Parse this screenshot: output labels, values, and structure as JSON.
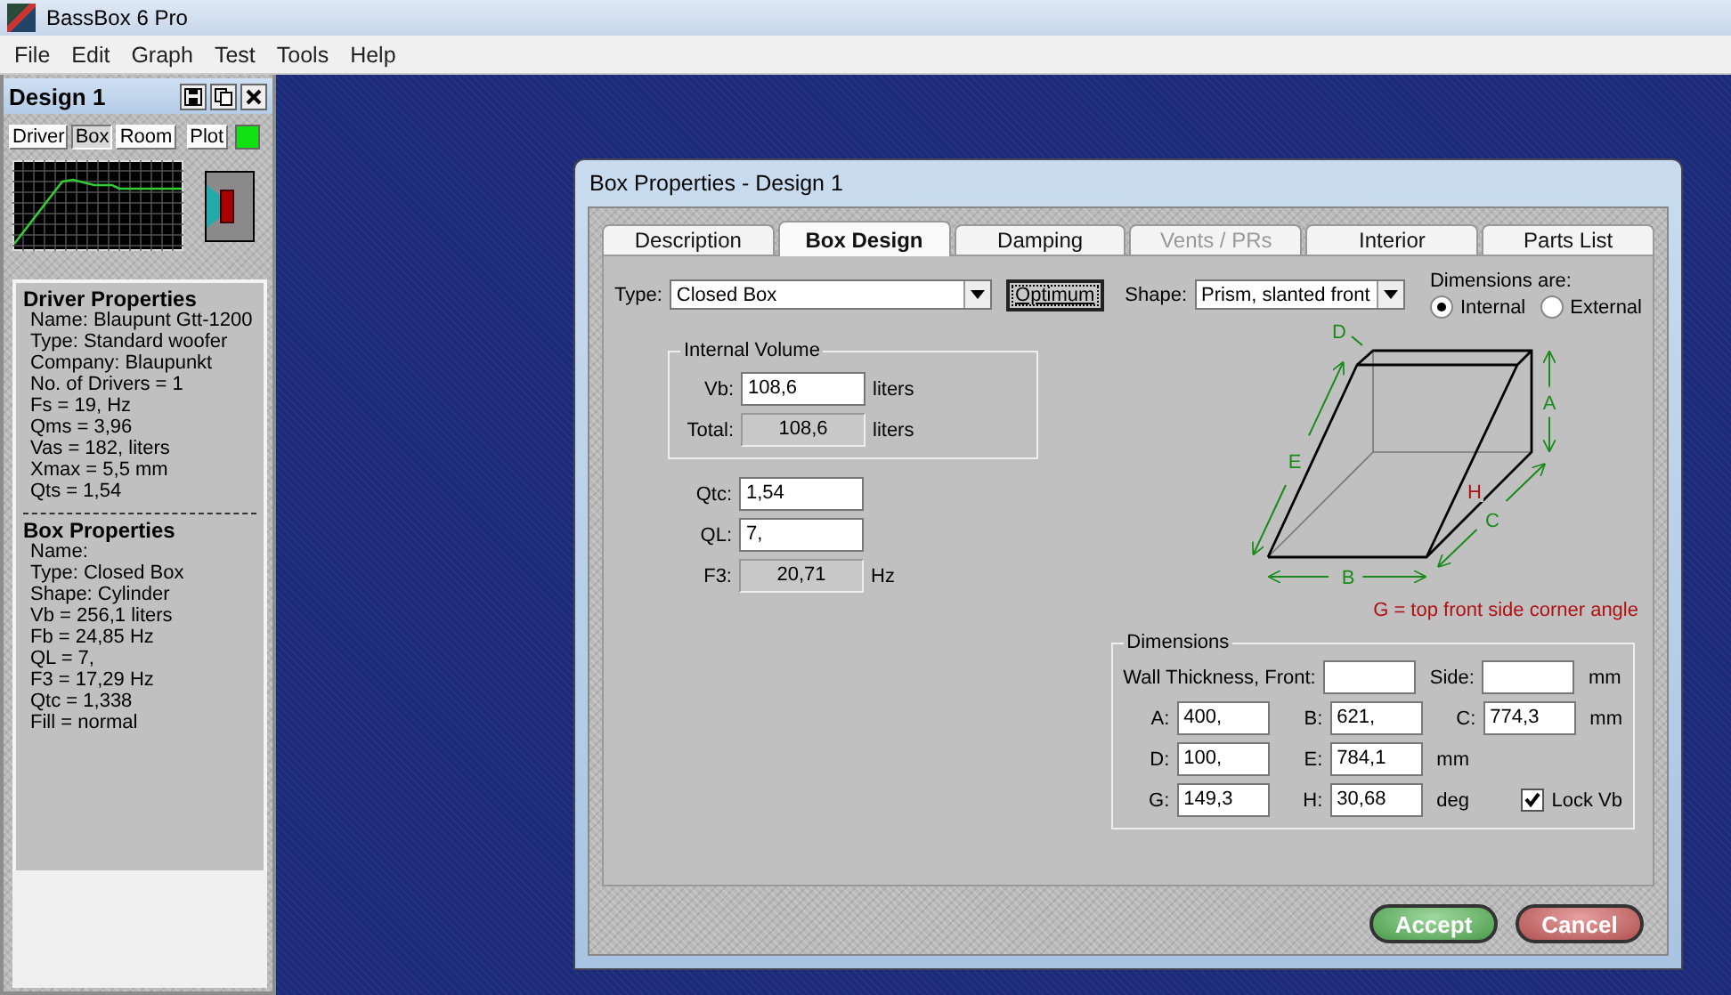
{
  "window": {
    "title": "BassBox 6 Pro"
  },
  "menu": [
    "File",
    "Edit",
    "Graph",
    "Test",
    "Tools",
    "Help"
  ],
  "side_panel": {
    "title": "Design 1",
    "tabs": [
      {
        "label": "Driver",
        "selected": false
      },
      {
        "label": "Box",
        "selected": true
      },
      {
        "label": "Room",
        "selected": false
      },
      {
        "label": "Plot",
        "selected": false
      }
    ],
    "driver_properties": {
      "heading": "Driver Properties",
      "lines": [
        "Name: Blaupunt Gtt-1200",
        "Type: Standard woofer",
        "Company: Blaupunkt",
        "No. of Drivers = 1",
        "Fs =  19, Hz",
        "Qms =  3,96",
        "Vas =  182, liters",
        "Xmax =  5,5 mm",
        "Qts =  1,54"
      ]
    },
    "box_properties": {
      "heading": "Box Properties",
      "lines": [
        "Name:",
        "Type: Closed Box",
        "Shape: Cylinder",
        "Vb =  256,1 liters",
        "Fb =  24,85 Hz",
        "QL =  7,",
        "F3 =  17,29 Hz",
        "Qtc =  1,338",
        "Fill = normal"
      ]
    }
  },
  "dialog": {
    "title": "Box Properties - Design 1",
    "tabs": [
      {
        "label": "Description",
        "selected": false,
        "disabled": false
      },
      {
        "label": "Box Design",
        "selected": true,
        "disabled": false
      },
      {
        "label": "Damping",
        "selected": false,
        "disabled": false
      },
      {
        "label": "Vents / PRs",
        "selected": false,
        "disabled": true
      },
      {
        "label": "Interior",
        "selected": false,
        "disabled": false
      },
      {
        "label": "Parts List",
        "selected": false,
        "disabled": false
      }
    ],
    "type": {
      "label": "Type:",
      "value": "Closed Box"
    },
    "optimum_button": "Optimum",
    "shape": {
      "label": "Shape:",
      "value": "Prism, slanted front"
    },
    "dimensions_are": {
      "label": "Dimensions are:",
      "options": [
        {
          "label": "Internal",
          "selected": true
        },
        {
          "label": "External",
          "selected": false
        }
      ]
    },
    "internal_volume": {
      "legend": "Internal Volume",
      "rows": [
        {
          "label": "Vb:",
          "value": "108,6",
          "unit": "liters",
          "editable": true
        },
        {
          "label": "Total:",
          "value": "108,6",
          "unit": "liters",
          "editable": false
        }
      ]
    },
    "q_fields": [
      {
        "label": "Qtc:",
        "value": "1,54",
        "editable": true
      },
      {
        "label": "QL:",
        "value": "7,",
        "editable": true
      },
      {
        "label": "F3:",
        "value": "20,71",
        "unit": "Hz",
        "editable": false
      }
    ],
    "diagram": {
      "labels": [
        {
          "text": "A",
          "color": "#1a8a1a"
        },
        {
          "text": "B",
          "color": "#1a8a1a"
        },
        {
          "text": "C",
          "color": "#1a8a1a"
        },
        {
          "text": "D",
          "color": "#1a8a1a"
        },
        {
          "text": "E",
          "color": "#1a8a1a"
        },
        {
          "text": "H",
          "color": "#b01010"
        }
      ],
      "caption": "G = top front side corner angle"
    },
    "dimensions": {
      "legend": "Dimensions",
      "wall": {
        "label": "Wall Thickness, Front:",
        "side_label": "Side:",
        "unit": "mm"
      },
      "rows": [
        {
          "fields": [
            {
              "label": "A:",
              "value": "400,"
            },
            {
              "label": "B:",
              "value": "621,"
            },
            {
              "label": "C:",
              "value": "774,3"
            }
          ],
          "unit": "mm"
        },
        {
          "fields": [
            {
              "label": "D:",
              "value": "100,"
            },
            {
              "label": "E:",
              "value": "784,1"
            }
          ],
          "unit": "mm"
        },
        {
          "fields": [
            {
              "label": "G:",
              "value": "149,3"
            },
            {
              "label": "H:",
              "value": "30,68"
            }
          ],
          "unit": "deg"
        }
      ],
      "lock": {
        "label": "Lock Vb",
        "checked": true
      }
    },
    "buttons": [
      {
        "label": "Accept",
        "kind": "accept"
      },
      {
        "label": "Cancel",
        "kind": "cancel"
      }
    ]
  }
}
